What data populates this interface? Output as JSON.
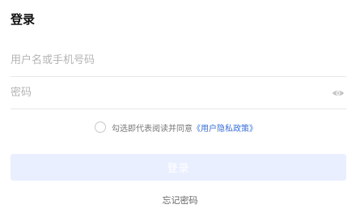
{
  "page": {
    "title": "登录"
  },
  "form": {
    "username": {
      "value": "",
      "placeholder": "用户名或手机号码"
    },
    "password": {
      "value": "",
      "placeholder": "密码",
      "toggle_icon": "eye-icon"
    },
    "agreement": {
      "checked": false,
      "text": "勾选即代表阅读并同意",
      "link_text": "《用户隐私政策》"
    },
    "login_label": "登录",
    "forgot_label": "忘记密码"
  },
  "colors": {
    "accent": "#3a6fd8",
    "button_bg_disabled": "#e9efff",
    "divider": "#e6e6e6",
    "placeholder": "#b4b4b4"
  }
}
